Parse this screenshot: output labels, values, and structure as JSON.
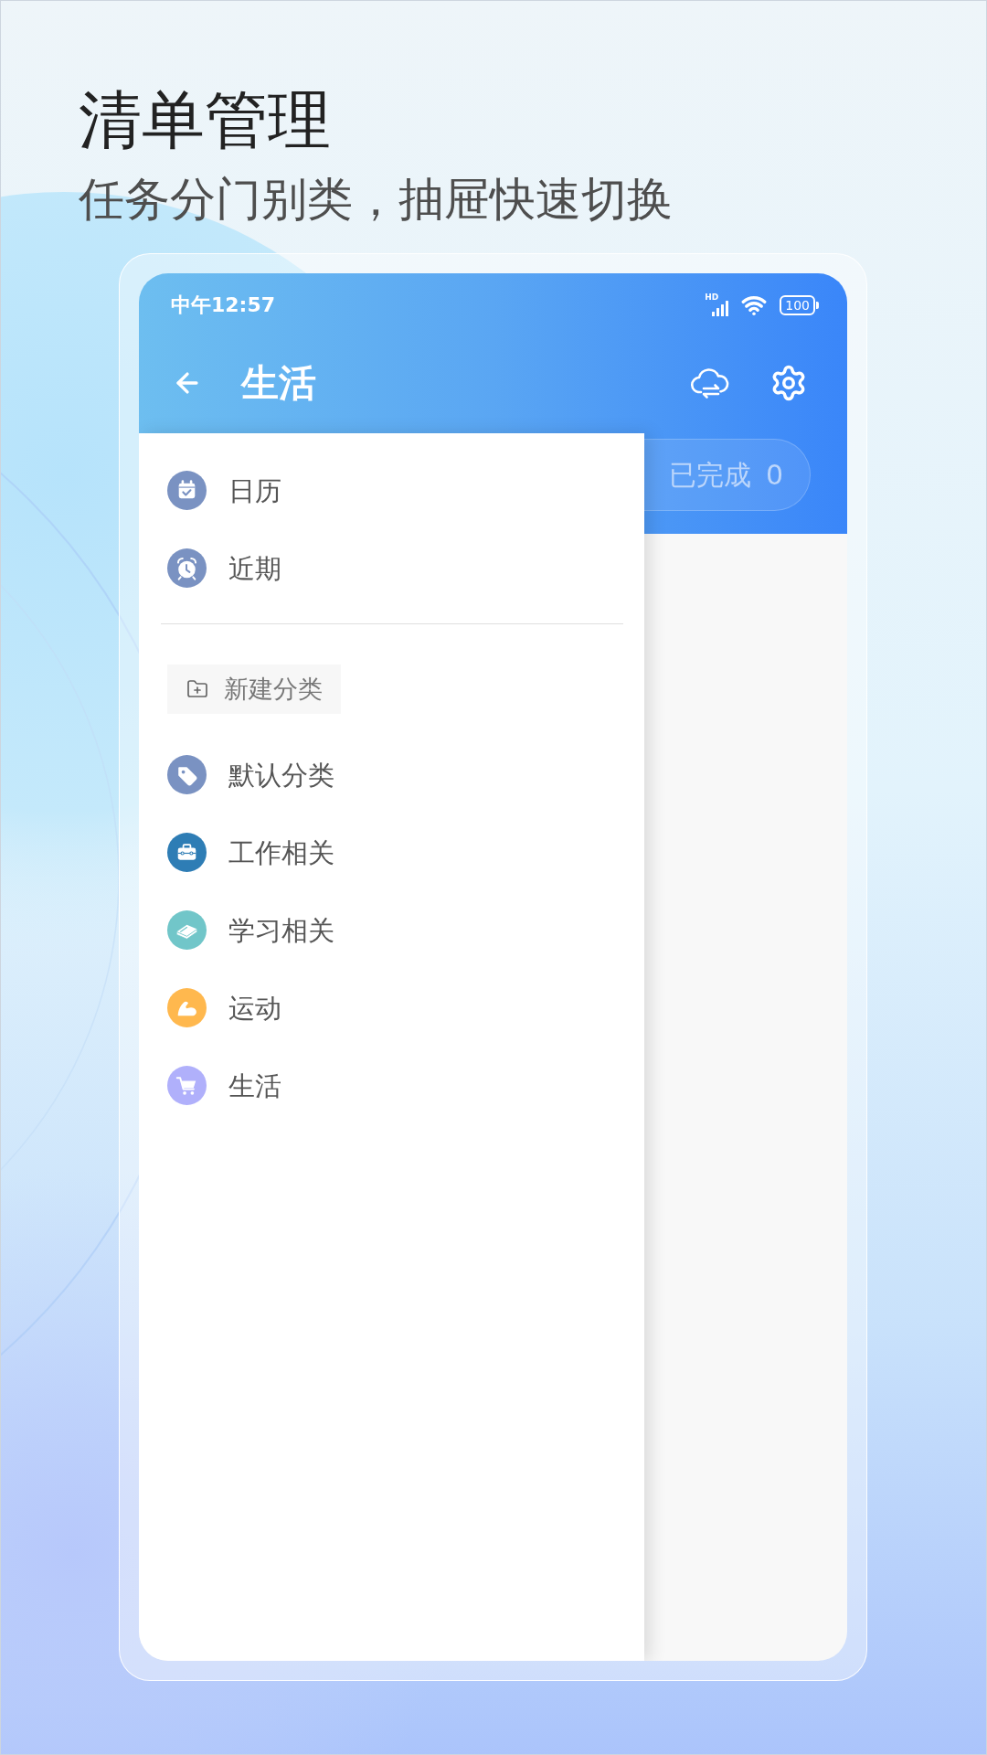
{
  "header": {
    "title": "清单管理",
    "subtitle": "任务分门别类，抽屉快速切换"
  },
  "status_bar": {
    "time": "中午12:57",
    "network": "HD",
    "battery": "100"
  },
  "app_bar": {
    "title": "生活"
  },
  "completed_tab": {
    "label": "已完成",
    "count": "0"
  },
  "drawer": {
    "nav_items": [
      {
        "label": "日历"
      },
      {
        "label": "近期"
      }
    ],
    "new_category_button": "新建分类",
    "categories": [
      {
        "label": "默认分类",
        "color": "#7a92c2"
      },
      {
        "label": "工作相关",
        "color": "#2e7db5"
      },
      {
        "label": "学习相关",
        "color": "#71c6c9"
      },
      {
        "label": "运动",
        "color": "#ffb84e"
      },
      {
        "label": "生活",
        "color": "#b0b0fb"
      }
    ]
  }
}
